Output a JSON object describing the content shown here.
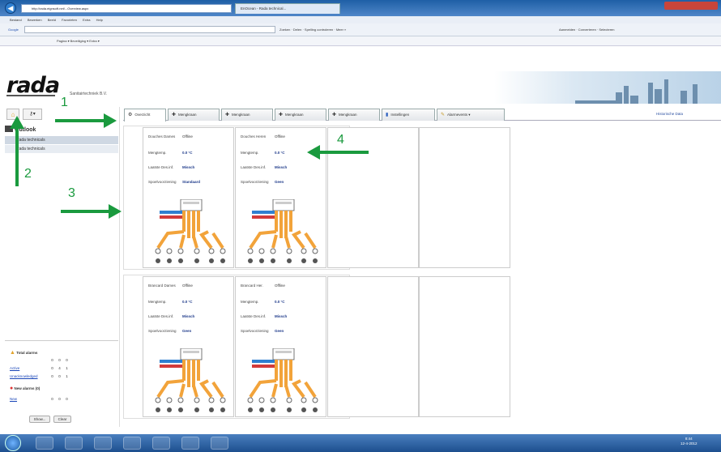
{
  "browser": {
    "address": "http://rada.eignsoft.net/...Overview.aspx",
    "tab_title": "EnOcean - Rada technical...",
    "menu": [
      "Bestand",
      "Bewerken",
      "Beeld",
      "Favorieten",
      "Extra",
      "Help"
    ],
    "search_label": "Google",
    "toolbar2_text": "Zoeken · Delen · Spelling controleren · Meer »",
    "toolbar2_right": "Aanmelden · Converteren · Selecteren",
    "toolbar3_text": "Pagina ▾  Beveiliging ▾  Extra ▾"
  },
  "app": {
    "logo": "rada",
    "company": "Sanitairtechniek B.V.",
    "sidebar": {
      "title": "Outlook",
      "items": [
        "Rada technicals",
        "Rada technicals"
      ]
    },
    "tabs": [
      {
        "label": "Overzicht",
        "icon": "⚙"
      },
      {
        "label": "Mengkraan",
        "icon": "✚"
      },
      {
        "label": "Mengkraan",
        "icon": "✚"
      },
      {
        "label": "Mengkraan",
        "icon": "✚"
      },
      {
        "label": "Mengkraan",
        "icon": "✚"
      },
      {
        "label": "Instellingen",
        "icon": "▮"
      },
      {
        "label": "Alarmevents ▾",
        "icon": "✎"
      }
    ],
    "history_link": "Historische Data",
    "panels": [
      {
        "name": "Douches Dames",
        "status": "Offline",
        "temp_label": "Mengtemp.",
        "temp": "0.0 °C",
        "last_label": "Laatste Des.inf.",
        "last": "Missch",
        "mode_label": "Spoelvoorziening",
        "mode": "Standaard"
      },
      {
        "name": "Douches Heren",
        "status": "Offline",
        "temp_label": "Mengtemp.",
        "temp": "0.0 °C",
        "last_label": "Laatste Des.inf.",
        "last": "Missch",
        "mode_label": "Spoelvoorziening",
        "mode": "Geen"
      },
      {
        "name": "Brancard Dames",
        "status": "Offline",
        "temp_label": "Mengtemp.",
        "temp": "0.0 °C",
        "last_label": "Laatste Des.inf.",
        "last": "Missch",
        "mode_label": "Spoelvoorziening",
        "mode": "Geen"
      },
      {
        "name": "Brancard Her.",
        "status": "Offline",
        "temp_label": "Mengtemp.",
        "temp": "0.0 °C",
        "last_label": "Laatste Des.inf.",
        "last": "Missch",
        "mode_label": "Spoelvoorziening",
        "mode": "Geen"
      }
    ],
    "alarms": {
      "total_label": "Total alarms",
      "header": [
        "",
        "0",
        "0",
        "0"
      ],
      "rows": [
        {
          "label": "Active",
          "values": [
            "0",
            "4",
            "1"
          ]
        },
        {
          "label": "Unacknowledged",
          "values": [
            "0",
            "0",
            "1"
          ]
        }
      ],
      "new_label": "New alarms (0)",
      "new_rows": [
        {
          "label": "New",
          "values": [
            "0",
            "0",
            "0"
          ]
        }
      ],
      "btn_show": "Show...",
      "btn_clear": "Clear"
    }
  },
  "annotations": {
    "n1": "1",
    "n2": "2",
    "n3": "3",
    "n4": "4"
  },
  "taskbar": {
    "time": "8:44",
    "date": "12-4-2012"
  },
  "colors": {
    "arrow": "#1a9a3e",
    "accent": "#1e3a8a",
    "pipe": "#f2a33a"
  }
}
